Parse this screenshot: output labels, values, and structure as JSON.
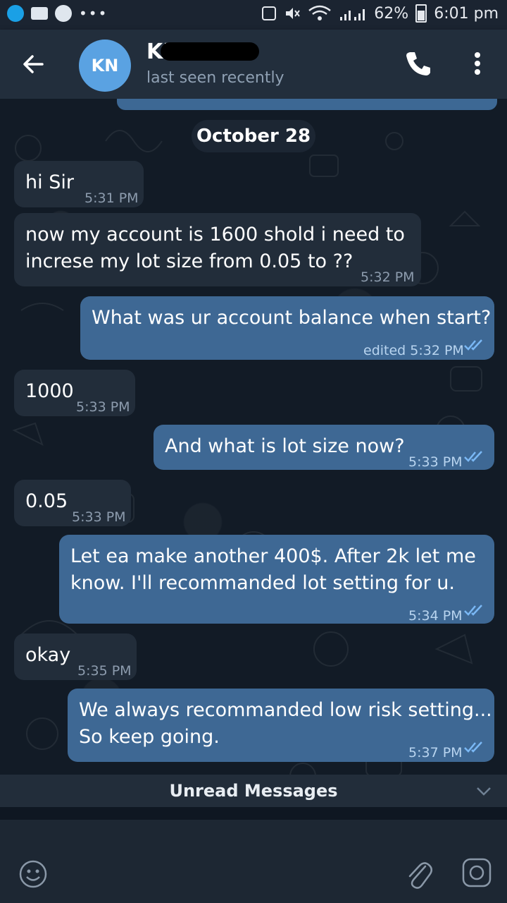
{
  "status_bar": {
    "battery_percent": "62%",
    "time": "6:01 pm"
  },
  "header": {
    "back_icon": "arrow-left-icon",
    "avatar_initials": "KN",
    "contact_name": "KK NG",
    "status": "last seen recently",
    "call_icon": "phone-icon",
    "menu_icon": "more-vertical-icon"
  },
  "chat": {
    "date_label": "October 28",
    "messages": [
      {
        "dir": "in",
        "text": "hi Sir",
        "time": "5:31 PM"
      },
      {
        "dir": "in",
        "text": "now my account is 1600 shold i need to\nincrese my lot size from 0.05 to ??",
        "time": "5:32 PM"
      },
      {
        "dir": "out",
        "text": "What was ur account balance when start?",
        "time": "edited 5:32 PM"
      },
      {
        "dir": "in",
        "text": "1000",
        "time": "5:33 PM"
      },
      {
        "dir": "out",
        "text": "And what is lot size now?",
        "time": "5:33 PM"
      },
      {
        "dir": "in",
        "text": "0.05",
        "time": "5:33 PM"
      },
      {
        "dir": "out",
        "text": "Let ea make another 400$. After 2k let me\nknow. I'll recommanded lot setting for u.",
        "time": "5:34 PM"
      },
      {
        "dir": "in",
        "text": "okay",
        "time": "5:35 PM"
      },
      {
        "dir": "out",
        "text": "We always recommanded low risk setting...\nSo keep going.",
        "time": "5:37 PM"
      }
    ],
    "unread_label": "Unread Messages"
  },
  "input_bar": {
    "emoji_icon": "emoji-icon",
    "attach_icon": "paperclip-icon",
    "camera_icon": "camera-icon"
  },
  "colors": {
    "outgoing_bubble": "#3e6894",
    "incoming_bubble": "#222d3a",
    "header": "#222e3c",
    "avatar": "#5aa2e2",
    "tick": "#7ab8f5"
  }
}
